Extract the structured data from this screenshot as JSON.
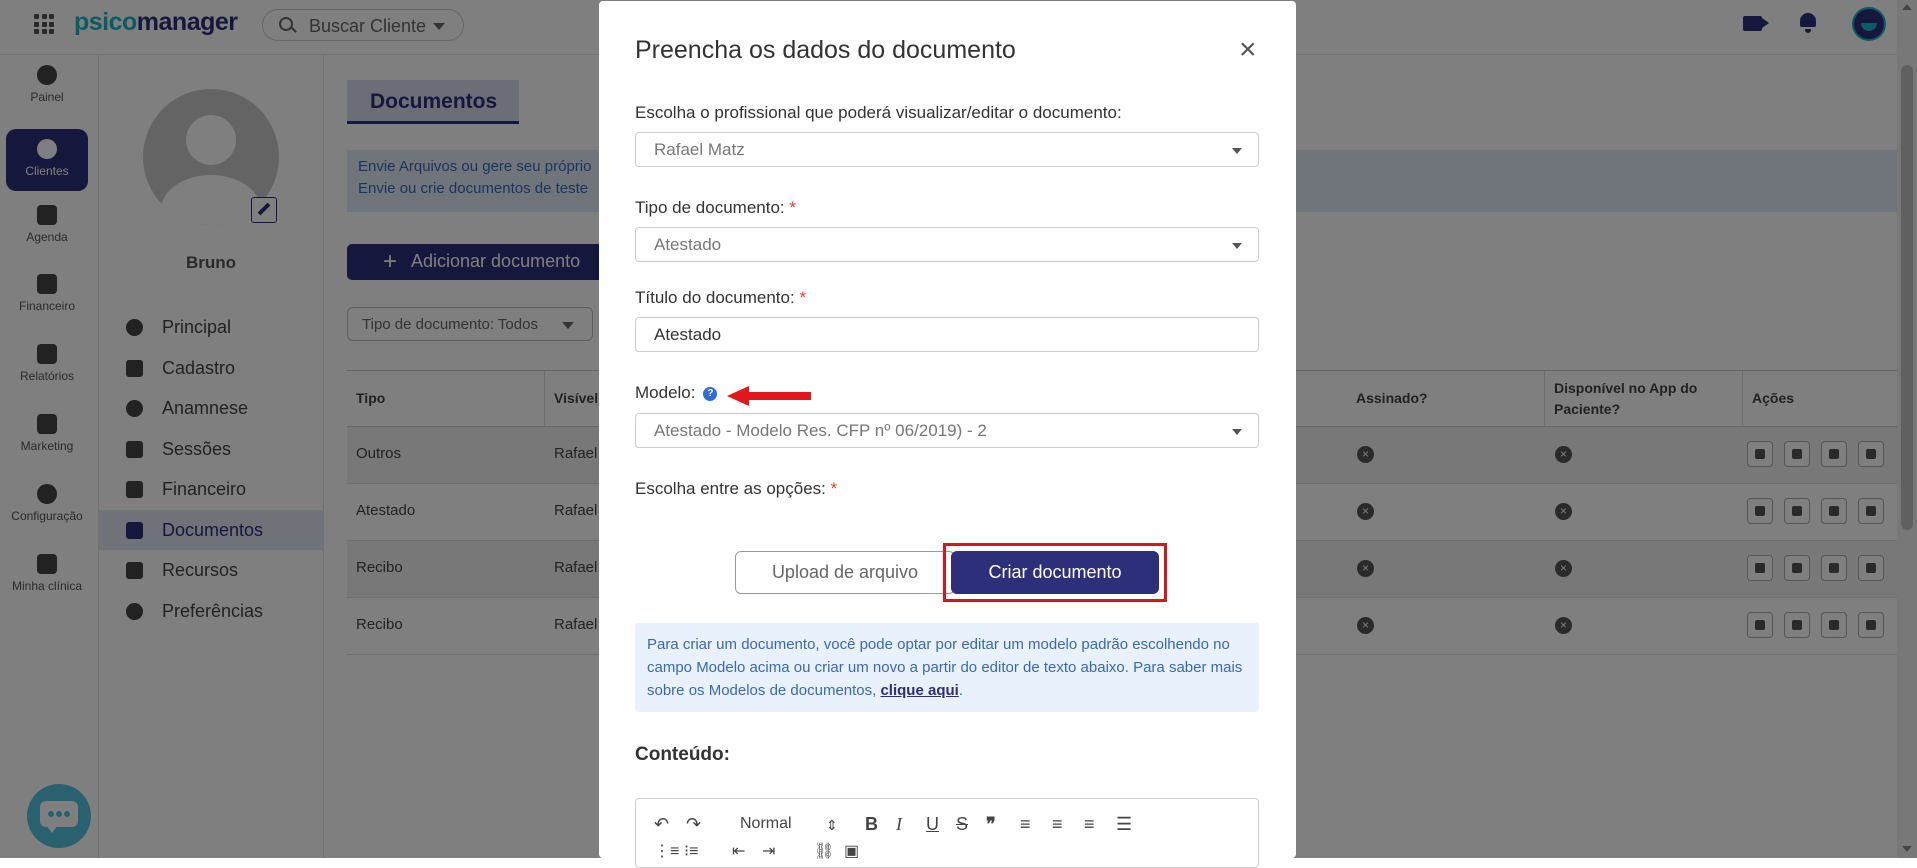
{
  "app": {
    "logo_part1": "psico",
    "logo_part2": "manager"
  },
  "topbar": {
    "search_placeholder": "Buscar Cliente"
  },
  "leftnav": {
    "items": [
      {
        "label": "Painel"
      },
      {
        "label": "Clientes",
        "active": true
      },
      {
        "label": "Agenda"
      },
      {
        "label": "Financeiro"
      },
      {
        "label": "Relatórios"
      },
      {
        "label": "Marketing"
      },
      {
        "label": "Configuração"
      },
      {
        "label": "Minha clínica"
      }
    ]
  },
  "patient": {
    "name": "Bruno",
    "menu": [
      {
        "label": "Principal"
      },
      {
        "label": "Cadastro"
      },
      {
        "label": "Anamnese"
      },
      {
        "label": "Sessões"
      },
      {
        "label": "Financeiro"
      },
      {
        "label": "Documentos",
        "active": true
      },
      {
        "label": "Recursos"
      },
      {
        "label": "Preferências"
      }
    ]
  },
  "main": {
    "tab": "Documentos",
    "banner_line1": "Envie Arquivos ou gere seu próprio",
    "banner_line2": "Envie ou crie documentos de teste",
    "add_button": "Adicionar documento",
    "filter_label": "Tipo de documento: Todos",
    "table": {
      "headers": [
        "Tipo",
        "Visível",
        "Assinado?",
        "Disponível no App do Paciente?",
        "Ações"
      ],
      "rows": [
        {
          "tipo": "Outros",
          "visivel": "Rafael"
        },
        {
          "tipo": "Atestado",
          "visivel": "Rafael"
        },
        {
          "tipo": "Recibo",
          "visivel": "Rafael"
        },
        {
          "tipo": "Recibo",
          "visivel": "Rafael"
        }
      ]
    }
  },
  "modal": {
    "title": "Preencha os dados do documento",
    "professional_label": "Escolha o profissional que poderá visualizar/editar o documento:",
    "professional_value": "Rafael Matz",
    "type_label": "Tipo de documento:",
    "type_value": "Atestado",
    "title_label": "Título do documento:",
    "title_value": "Atestado",
    "model_label": "Modelo:",
    "model_value": "Atestado - Modelo Res. CFP nº 06/2019) - 2",
    "options_label": "Escolha entre as opções:",
    "upload_button": "Upload de arquivo",
    "create_button": "Criar documento",
    "info_text": "Para criar um documento, você pode optar por editar um modelo padrão escolhendo no campo Modelo acima ou criar um novo a partir do editor de texto abaixo. Para saber mais sobre os Modelos de documentos, ",
    "info_link": "clique aqui",
    "info_end": ".",
    "content_label": "Conteúdo:",
    "editor_format": "Normal",
    "required_mark": "*",
    "help_mark": "?"
  },
  "colors": {
    "brand_dark": "#2d2f7a",
    "brand_light": "#18b5c9",
    "highlight": "#d9141b"
  }
}
